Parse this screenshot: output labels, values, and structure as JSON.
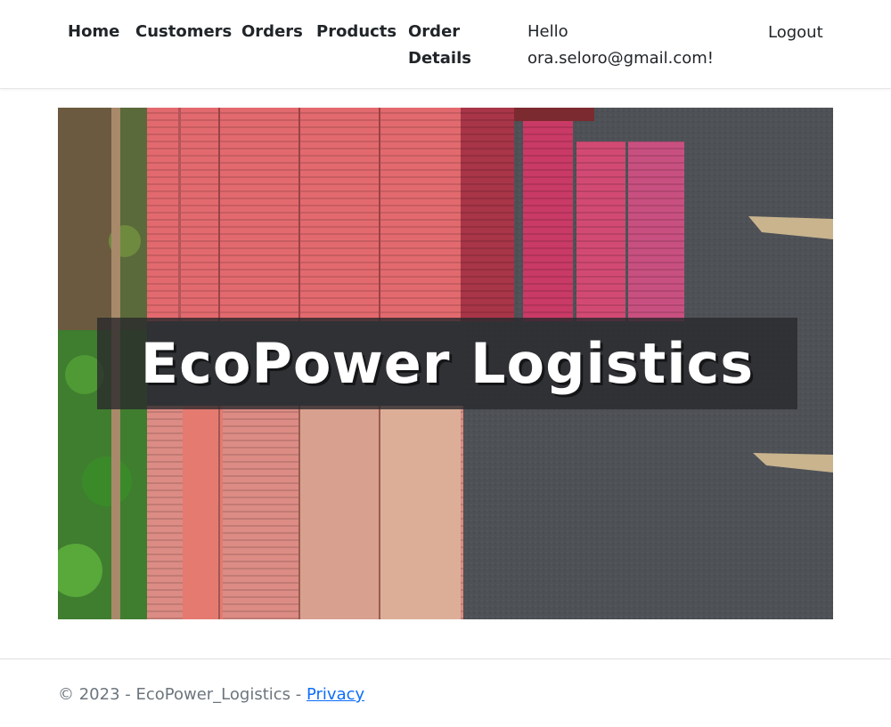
{
  "nav": {
    "home": "Home",
    "customers": "Customers",
    "orders": "Orders",
    "products": "Products",
    "order_details": "Order Details",
    "greeting": "Hello ora.seloro@gmail.com!",
    "logout": "Logout"
  },
  "hero": {
    "title": "EcoPower Logistics"
  },
  "footer": {
    "copyright": "© 2023 - EcoPower_Logistics - ",
    "privacy": "Privacy"
  },
  "colors": {
    "link": "#0d6efd",
    "footer_text": "#6c757d",
    "container_red": "#e26a6e",
    "container_pink": "#c93a66",
    "ground": "#4b4d52"
  }
}
